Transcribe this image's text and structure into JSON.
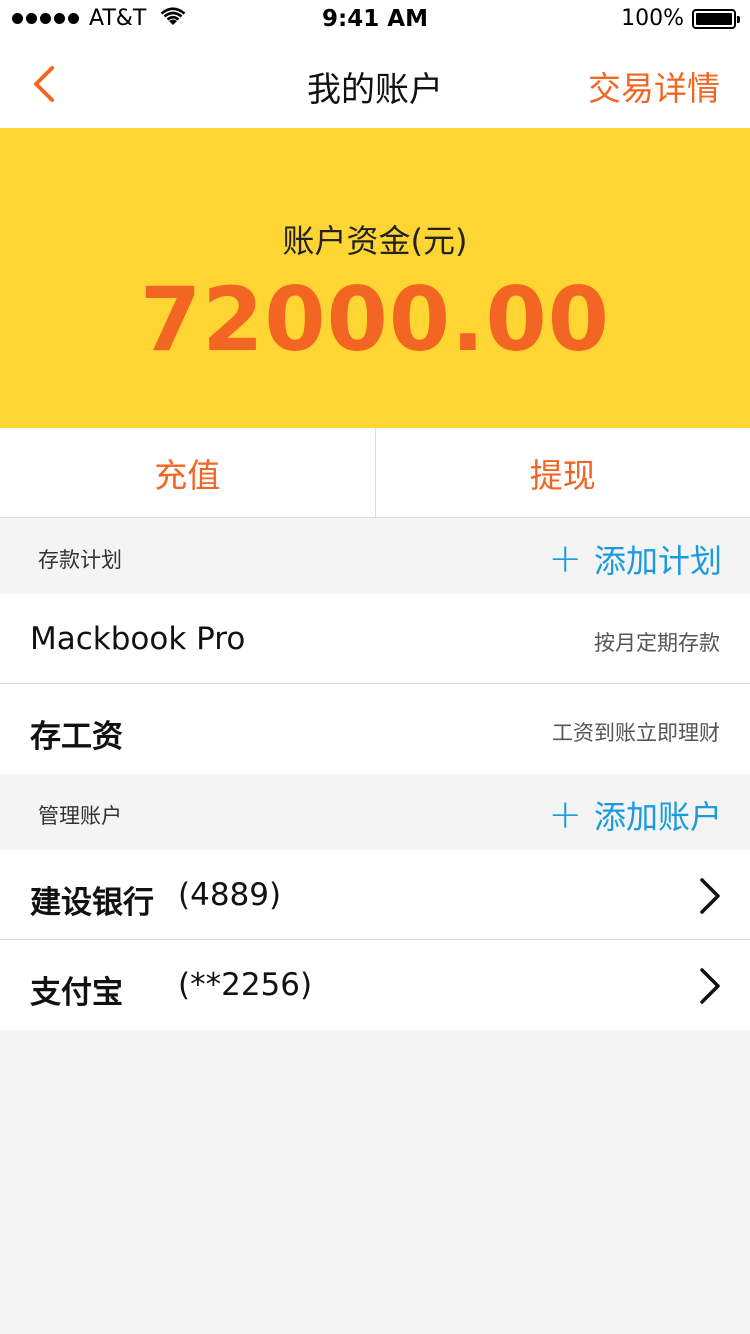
{
  "status_bar": {
    "carrier": "AT&T",
    "time": "9:41 AM",
    "battery": "100%"
  },
  "nav": {
    "title": "我的账户",
    "right_action": "交易详情"
  },
  "balance": {
    "label": "账户资金(元)",
    "amount": "72000.00"
  },
  "actions": {
    "recharge": "充值",
    "withdraw": "提现"
  },
  "savings_section": {
    "title": "存款计划",
    "action": "添加计划",
    "items": [
      {
        "name": "Mackbook Pro",
        "note": "按月定期存款"
      },
      {
        "name": "存工资",
        "note": "工资到账立即理财"
      }
    ]
  },
  "accounts_section": {
    "title": "管理账户",
    "action": "添加账户",
    "items": [
      {
        "name": "建设银行",
        "number": "(4889)"
      },
      {
        "name": "支付宝",
        "number": "(**2256)"
      }
    ]
  },
  "colors": {
    "accent_orange": "#f26522",
    "banner_yellow": "#ffd533",
    "link_blue": "#1a9be0"
  }
}
